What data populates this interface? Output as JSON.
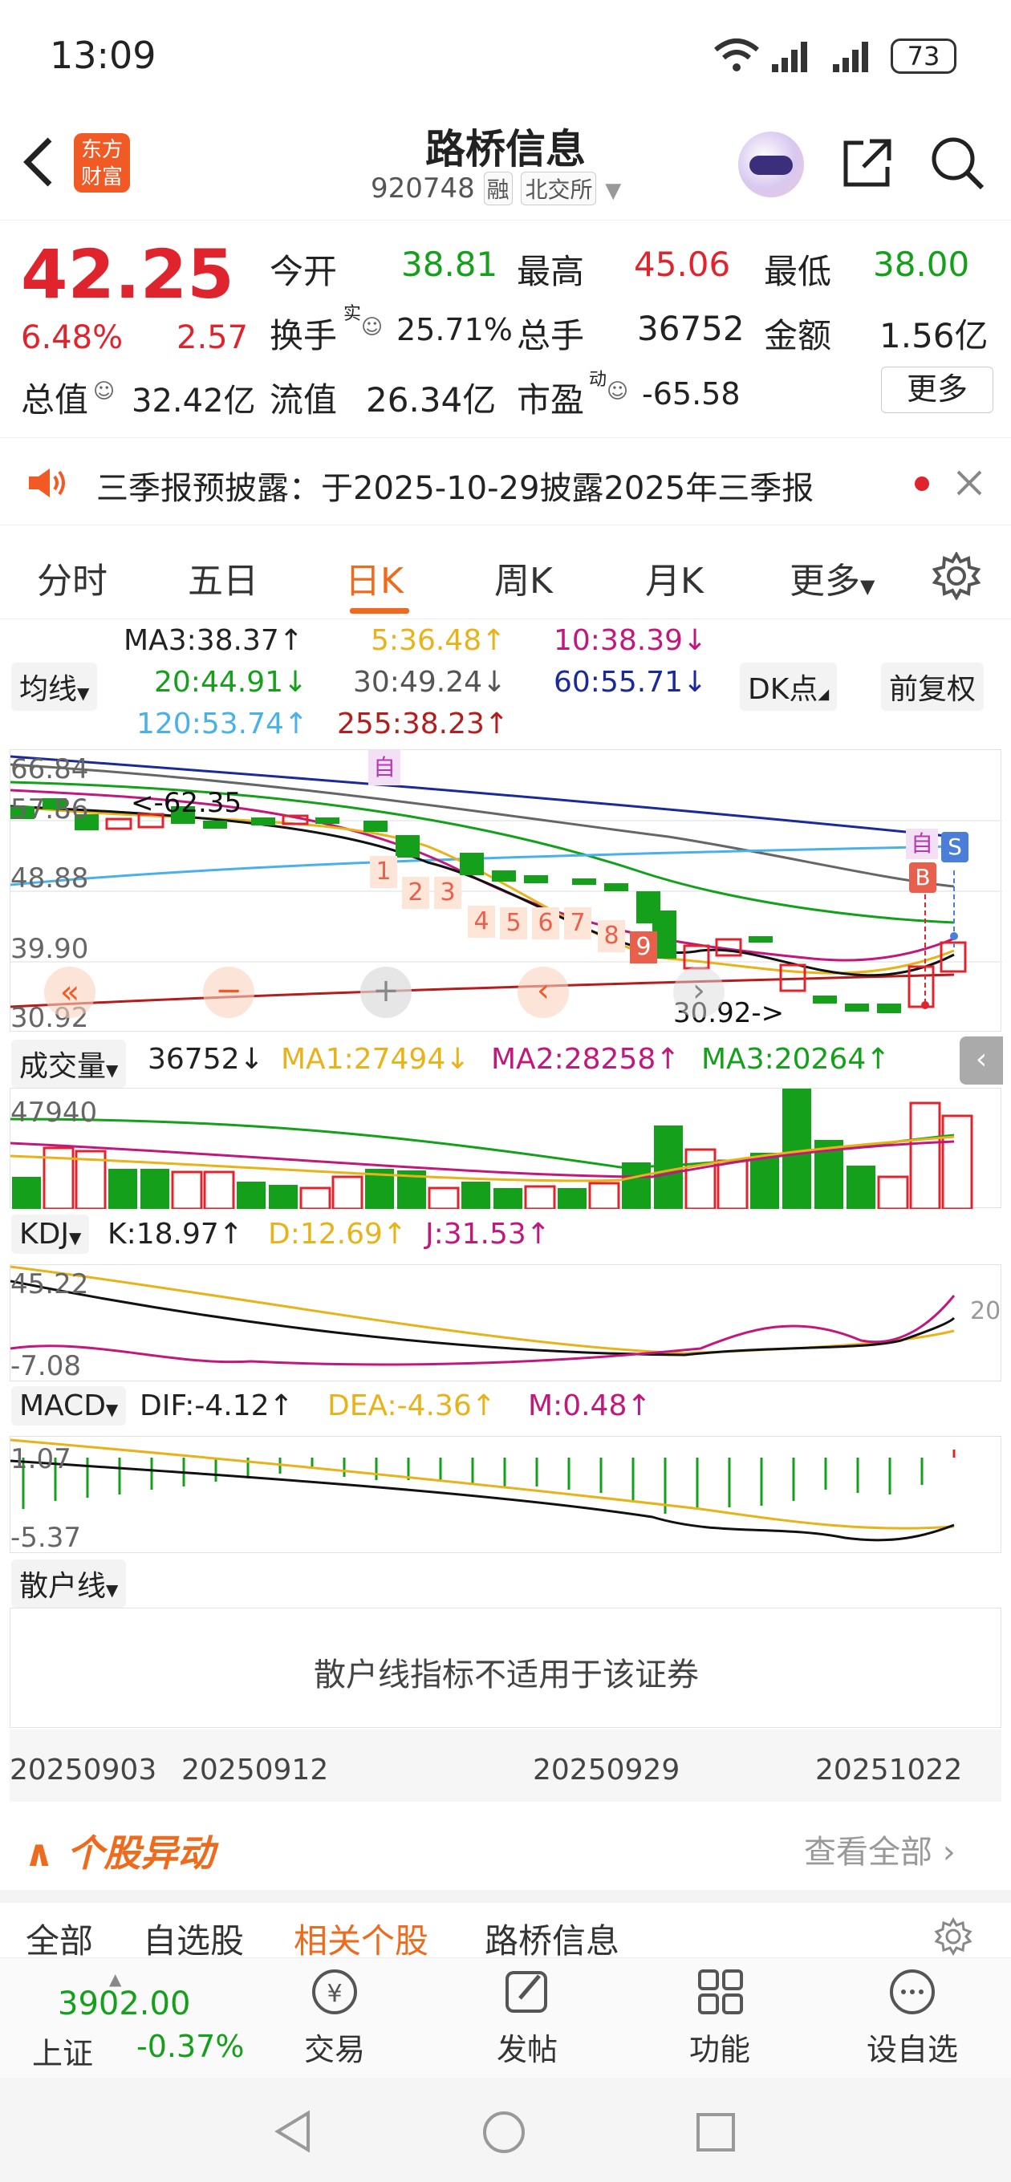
{
  "status": {
    "time": "13:09",
    "battery": "73"
  },
  "header": {
    "logo_line1": "东方",
    "logo_line2": "财富",
    "name": "路桥信息",
    "code": "920748",
    "tag_margin": "融",
    "exchange": "北交所"
  },
  "quote": {
    "price": "42.25",
    "change_pct": "6.48%",
    "change": "2.57",
    "open_label": "今开",
    "open": "38.81",
    "high_label": "最高",
    "high": "45.06",
    "low_label": "最低",
    "low": "38.00",
    "turnover_label": "换手",
    "turnover_sup": "实",
    "turnover": "25.71%",
    "volume_label": "总手",
    "volume": "36752",
    "amount_label": "金额",
    "amount": "1.56亿",
    "mktcap_label": "总值",
    "mktcap": "32.42亿",
    "float_label": "流值",
    "float": "26.34亿",
    "pe_label": "市盈",
    "pe_sup": "动",
    "pe": "-65.58",
    "more": "更多"
  },
  "notice": {
    "text": "三季报预披露：于2025-10-29披露2025年三季报"
  },
  "tabs": [
    "分时",
    "五日",
    "日K",
    "周K",
    "月K",
    "更多"
  ],
  "ma": {
    "selector": "均线",
    "ma3": "MA3:38.37↑",
    "ma5": "5:36.48↑",
    "ma10": "10:38.39↓",
    "ma20": "20:44.91↓",
    "ma30": "30:49.24↓",
    "ma60": "60:55.71↓",
    "ma120": "120:53.74↑",
    "ma255": "255:38.23↑",
    "dk": "DK点",
    "adjust": "前复权"
  },
  "kline": {
    "y_labels": [
      "66.84",
      "57.86",
      "48.88",
      "39.90",
      "30.92"
    ],
    "hi_note": "<-62.35",
    "lo_note": "30.92->",
    "zi_marker": "自",
    "b_marker": "B",
    "s_marker": "S",
    "seq_numbers": [
      "1",
      "2",
      "3",
      "4",
      "5",
      "6",
      "7",
      "8",
      "9"
    ]
  },
  "volume": {
    "selector": "成交量",
    "value": "36752↓",
    "ma1": "MA1:27494↓",
    "ma2": "MA2:28258↑",
    "ma3": "MA3:20264↑",
    "y_top": "47940"
  },
  "kdj": {
    "selector": "KDJ",
    "k": "K:18.97↑",
    "d": "D:12.69↑",
    "j": "J:31.53↑",
    "y_top": "45.22",
    "y_bottom": "-7.08",
    "right_label": "20"
  },
  "macd": {
    "selector": "MACD",
    "dif": "DIF:-4.12↑",
    "dea": "DEA:-4.36↑",
    "m": "M:0.48↑",
    "y_top": "1.07",
    "y_bottom": "-5.37"
  },
  "retail": {
    "selector": "散户线",
    "message": "散户线指标不适用于该证券"
  },
  "dates": [
    "20250903",
    "20250912",
    "20250929",
    "20251022"
  ],
  "movers": {
    "title": "个股异动",
    "view_all": "查看全部",
    "tabs": [
      "全部",
      "自选股",
      "相关个股",
      "路桥信息"
    ]
  },
  "bottom": {
    "index_value": "3902.00",
    "index_name": "上证",
    "index_change": "-0.37%",
    "trade": "交易",
    "post": "发帖",
    "func": "功能",
    "watch": "设自选"
  },
  "colors": {
    "up": "#e0242d",
    "down": "#14a01a",
    "accent": "#ee6a1c"
  }
}
